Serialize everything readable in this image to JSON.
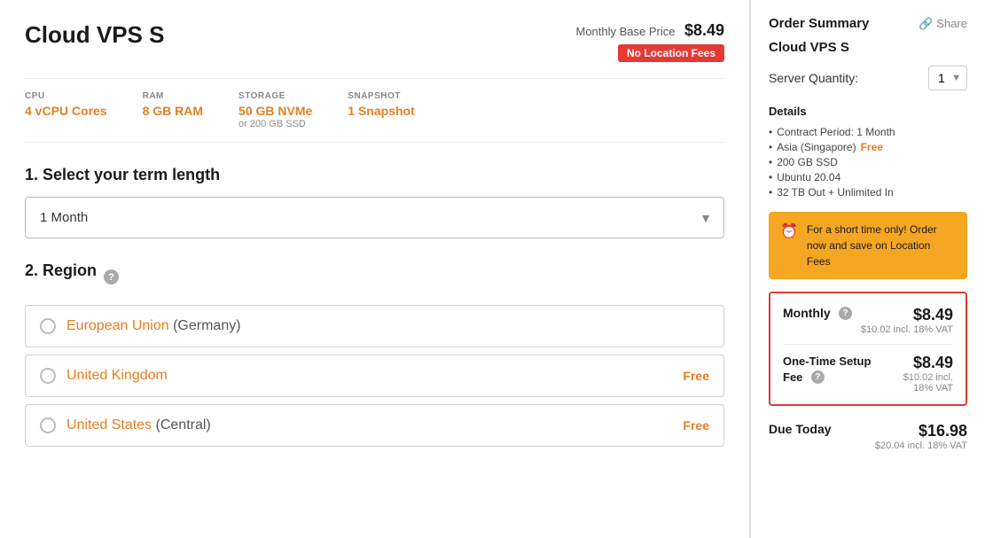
{
  "product": {
    "title": "Cloud VPS S",
    "monthly_base_label": "Monthly Base Price",
    "monthly_base_price": "$8.49",
    "no_location_badge": "No Location Fees"
  },
  "specs": [
    {
      "label": "CPU",
      "value": "4 vCPU Cores",
      "sub": ""
    },
    {
      "label": "RAM",
      "value": "8 GB RAM",
      "sub": ""
    },
    {
      "label": "STORAGE",
      "value": "50 GB NVMe",
      "sub": "or 200 GB SSD"
    },
    {
      "label": "SNAPSHOT",
      "value": "1 Snapshot",
      "sub": ""
    }
  ],
  "term": {
    "section_label": "1. Select your term length",
    "selected": "1 Month"
  },
  "region": {
    "section_label": "2. Region",
    "options": [
      {
        "name": "European Union",
        "country": "(Germany)",
        "free": false
      },
      {
        "name": "United Kingdom",
        "country": "",
        "free": true
      },
      {
        "name": "United States",
        "country": "(Central)",
        "free": true
      }
    ]
  },
  "sidebar": {
    "title": "Order Summary",
    "share_label": "Share",
    "product_name": "Cloud VPS S",
    "quantity_label": "Server Quantity:",
    "quantity_value": "1",
    "details_title": "Details",
    "details": [
      {
        "text": "Contract Period: 1 Month",
        "free": false
      },
      {
        "text": "Asia (Singapore)",
        "free": true,
        "free_label": "Free"
      },
      {
        "text": "200 GB SSD",
        "free": false
      },
      {
        "text": "Ubuntu 20.04",
        "free": false
      },
      {
        "text": "32 TB Out + Unlimited In",
        "free": false
      }
    ],
    "promo_text": "For a short time only! Order now and save on Location Fees",
    "monthly_label": "Monthly",
    "monthly_amount": "$8.49",
    "monthly_vat": "$10.02 incl. 18% VAT",
    "setup_label": "One-Time Setup Fee",
    "setup_amount": "$8.49",
    "setup_vat": "$10.02 incl. 18% VAT",
    "due_label": "Due Today",
    "due_amount": "$16.98",
    "due_vat": "$20.04 incl. 18% VAT"
  }
}
